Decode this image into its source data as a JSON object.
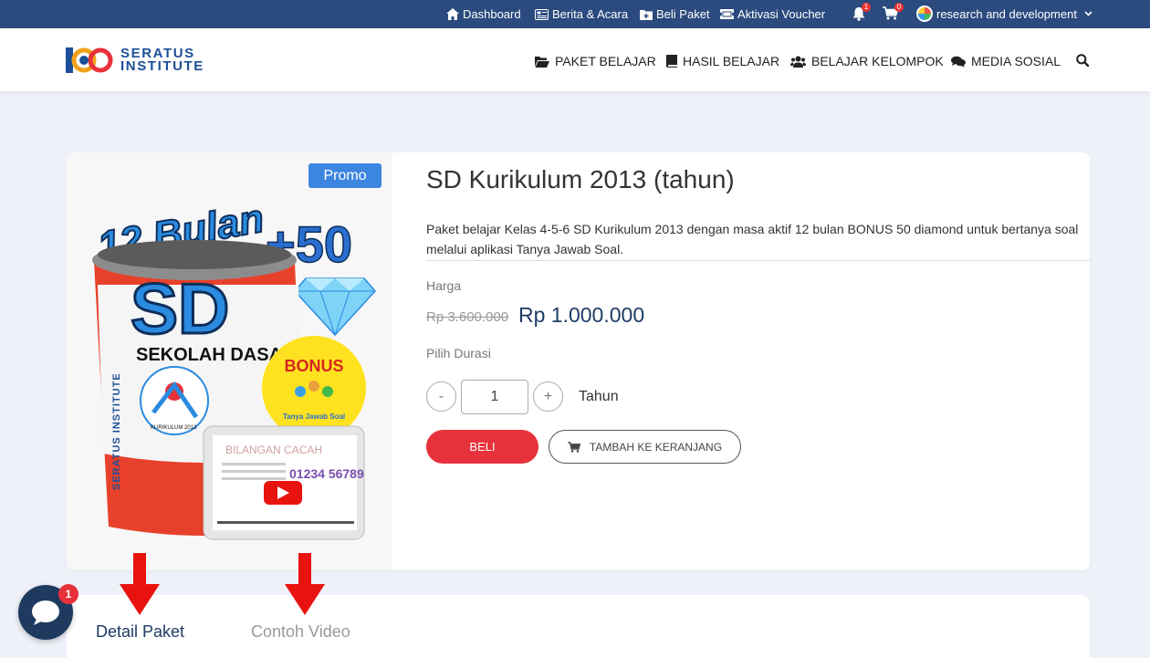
{
  "topbar": {
    "items": [
      {
        "label": "Dashboard",
        "icon": "home-icon"
      },
      {
        "label": "Berita & Acara",
        "icon": "newspaper-icon"
      },
      {
        "label": "Beli Paket",
        "icon": "folder-plus-icon"
      },
      {
        "label": "Aktivasi Voucher",
        "icon": "ticket-icon"
      }
    ],
    "notifications_count": "1",
    "cart_count": "0",
    "user_name": "research and development"
  },
  "navbar": {
    "logo_line1": "SERATUS",
    "logo_line2": "INSTITUTE",
    "items": [
      {
        "label": "PAKET BELAJAR",
        "icon": "folder-open-icon"
      },
      {
        "label": "HASIL BELAJAR",
        "icon": "book-icon"
      },
      {
        "label": "BELAJAR KELOMPOK",
        "icon": "users-icon"
      },
      {
        "label": "MEDIA SOSIAL",
        "icon": "comments-icon"
      }
    ]
  },
  "product": {
    "badge": "Promo",
    "image": {
      "headline": "12 Bulan",
      "plus_text": "+50",
      "can_title": "SD",
      "can_subtitle": "SEKOLAH DASAR",
      "can_brand": "SERATUS INSTITUTE",
      "curriculum_label": "KURIKULUM 2013",
      "bonus_label": "BONUS",
      "bonus_caption": "Tanya Jawab Soal",
      "tablet_title": "BILANGAN CACAH",
      "tablet_digits": "01234 56789"
    },
    "title": "SD Kurikulum 2013 (tahun)",
    "description": "Paket belajar Kelas 4-5-6 SD Kurikulum 2013 dengan masa aktif 12 bulan BONUS 50 diamond untuk bertanya soal melalui aplikasi Tanya Jawab Soal.",
    "price_label": "Harga",
    "old_price": "Rp 3.600.000",
    "new_price": "Rp 1.000.000",
    "duration_label": "Pilih Durasi",
    "minus": "-",
    "quantity": "1",
    "plus": "+",
    "unit": "Tahun",
    "buy_label": "BELI",
    "add_to_cart_label": "TAMBAH KE KERANJANG"
  },
  "tabs": [
    {
      "label": "Detail Paket",
      "active": true
    },
    {
      "label": "Contoh Video",
      "active": false
    }
  ],
  "chat": {
    "badge": "1"
  },
  "colors": {
    "topbar": "#2b4a7e",
    "accent_blue": "#3d86e0",
    "buy_red": "#e8323b",
    "price_navy": "#1f3b66"
  }
}
